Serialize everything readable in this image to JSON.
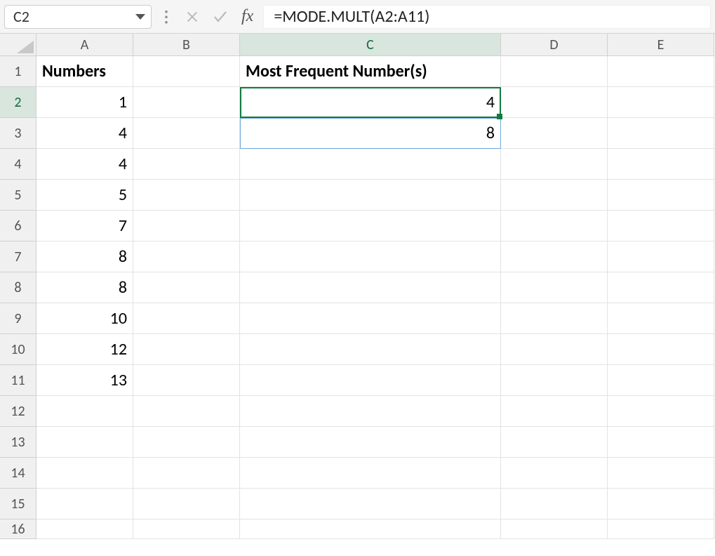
{
  "formula_bar": {
    "cell_ref": "C2",
    "formula": "=MODE.MULT(A2:A11)"
  },
  "columns": [
    "A",
    "B",
    "C",
    "D",
    "E"
  ],
  "rows": [
    "1",
    "2",
    "3",
    "4",
    "5",
    "6",
    "7",
    "8",
    "9",
    "10",
    "11",
    "12",
    "13",
    "14",
    "15",
    "16"
  ],
  "headers": {
    "A1": "Numbers",
    "C1": "Most Frequent Number(s)"
  },
  "numbers_col": [
    "1",
    "4",
    "4",
    "5",
    "7",
    "8",
    "8",
    "10",
    "12",
    "13"
  ],
  "results_col": [
    "4",
    "8"
  ],
  "active_cell": "C2",
  "chart_data": {
    "type": "table",
    "columns": [
      "Numbers"
    ],
    "values": [
      1,
      4,
      4,
      5,
      7,
      8,
      8,
      10,
      12,
      13
    ],
    "result_label": "Most Frequent Number(s)",
    "result_values": [
      4,
      8
    ],
    "formula": "=MODE.MULT(A2:A11)"
  }
}
